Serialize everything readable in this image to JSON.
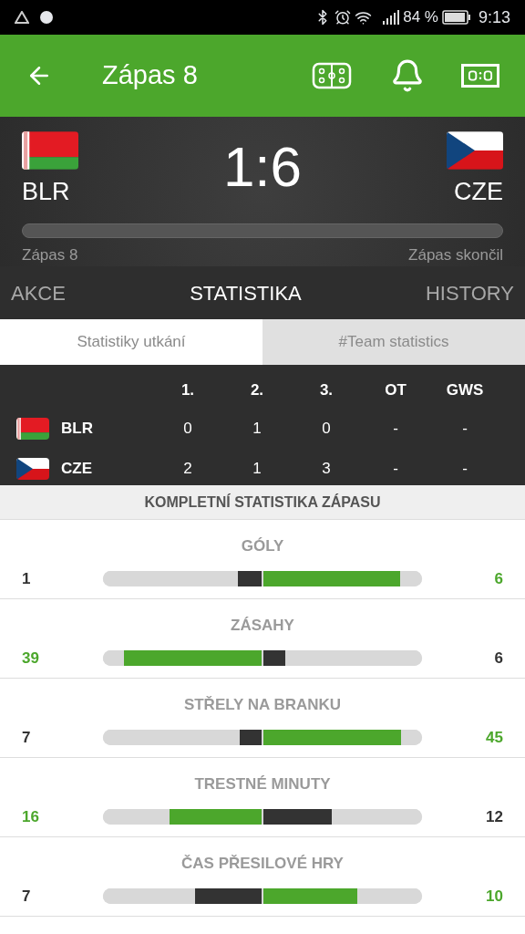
{
  "status_bar": {
    "battery": "84 %",
    "time": "9:13"
  },
  "app_bar": {
    "title": "Zápas 8"
  },
  "scoreboard": {
    "home": {
      "code": "BLR",
      "flag": {
        "kind": "blr"
      }
    },
    "away": {
      "code": "CZE",
      "flag": {
        "kind": "cze"
      }
    },
    "score": "1:6",
    "left_label": "Zápas 8",
    "right_label": "Zápas skončil"
  },
  "tabs": [
    {
      "label": "AKCE",
      "selected": false
    },
    {
      "label": "STATISTIKA",
      "selected": true
    },
    {
      "label": "HISTORY",
      "selected": false
    }
  ],
  "subtabs": [
    {
      "label": "Statistiky utkání",
      "selected": true
    },
    {
      "label": "#Team statistics",
      "selected": false
    }
  ],
  "periods": {
    "columns": [
      "1.",
      "2.",
      "3.",
      "OT",
      "GWS"
    ],
    "rows": [
      {
        "team": "BLR",
        "flag": {
          "kind": "blr"
        },
        "cells": [
          "0",
          "1",
          "0",
          "-",
          "-"
        ]
      },
      {
        "team": "CZE",
        "flag": {
          "kind": "cze"
        },
        "cells": [
          "2",
          "1",
          "3",
          "-",
          "-"
        ]
      }
    ]
  },
  "stats_header": "KOMPLETNÍ STATISTIKA ZÁPASU",
  "stats": [
    {
      "title": "GÓLY",
      "left": {
        "value": "1",
        "level": 0.15,
        "color": "#333333"
      },
      "right": {
        "value": "6",
        "level": 0.86,
        "color": "#4ca72c"
      }
    },
    {
      "title": "ZÁSAHY",
      "left": {
        "value": "39",
        "level": 0.87,
        "color": "#4ca72c"
      },
      "right": {
        "value": "6",
        "level": 0.14,
        "color": "#333333"
      }
    },
    {
      "title": "STŘELY NA BRANKU",
      "left": {
        "value": "7",
        "level": 0.14,
        "color": "#333333"
      },
      "right": {
        "value": "45",
        "level": 0.87,
        "color": "#4ca72c"
      }
    },
    {
      "title": "TRESTNÉ MINUTY",
      "left": {
        "value": "16",
        "level": 0.58,
        "color": "#4ca72c"
      },
      "right": {
        "value": "12",
        "level": 0.43,
        "color": "#333333"
      }
    },
    {
      "title": "ČAS PŘESILOVÉ HRY",
      "left": {
        "value": "7",
        "level": 0.42,
        "color": "#333333"
      },
      "right": {
        "value": "10",
        "level": 0.59,
        "color": "#4ca72c"
      }
    }
  ]
}
